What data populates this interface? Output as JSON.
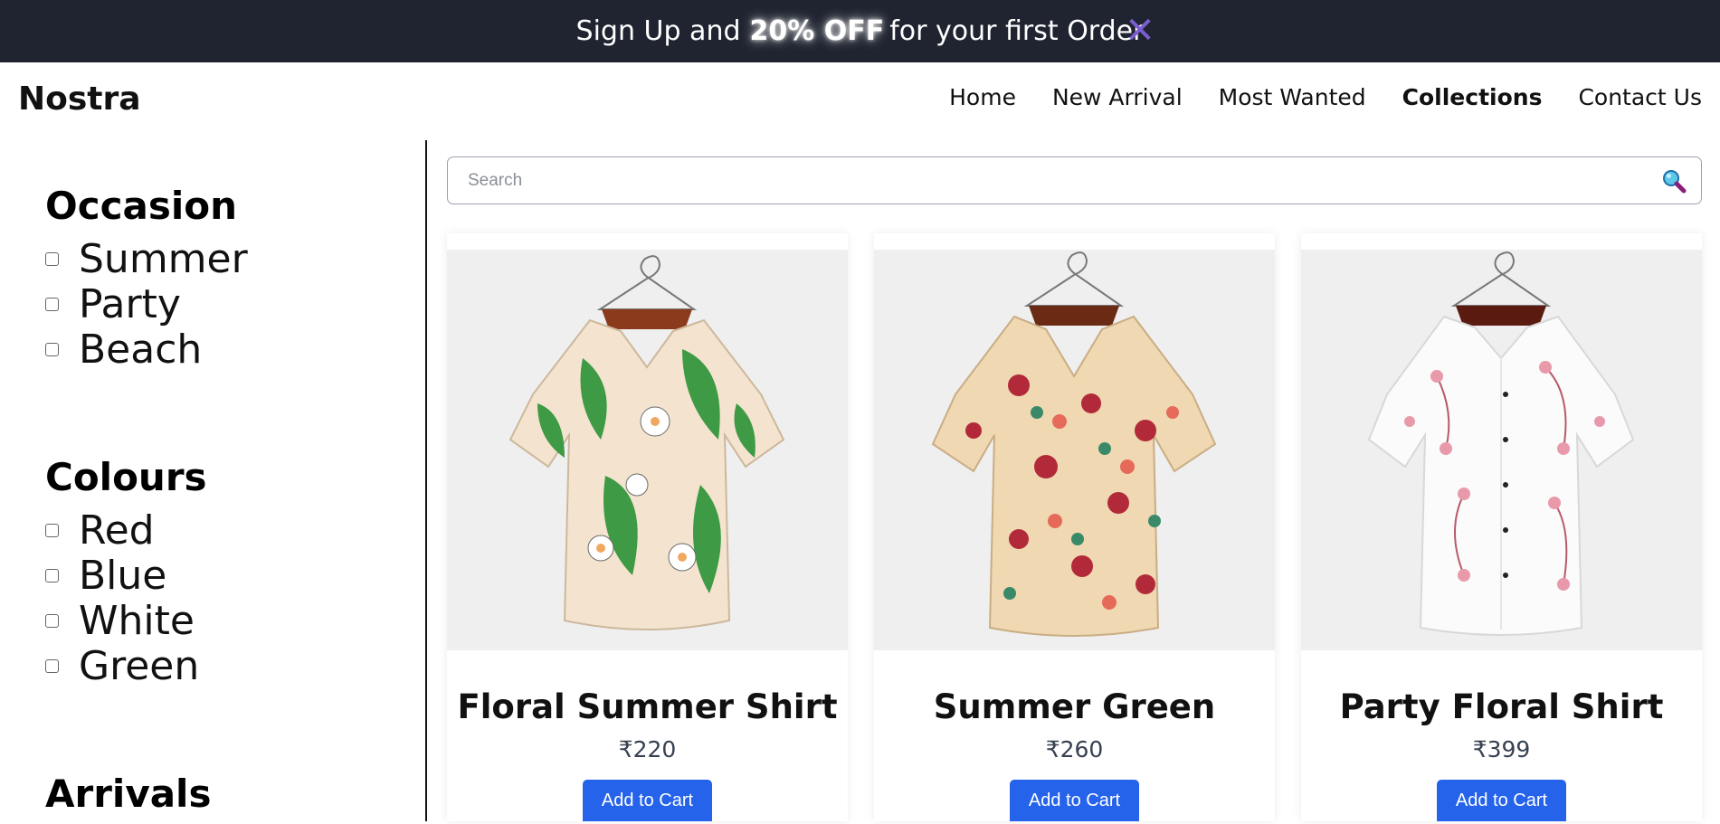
{
  "promo": {
    "pre_text": "Sign Up and",
    "highlight_text": "20% OFF",
    "post_text": "for your first Order",
    "close_glyph": "✕",
    "background_color": "#1f2430",
    "close_color": "#7b5fd0"
  },
  "header": {
    "brand": "Nostra",
    "nav": [
      {
        "label": "Home"
      },
      {
        "label": "New Arrival"
      },
      {
        "label": "Most Wanted"
      },
      {
        "label": "Collections",
        "active": true
      },
      {
        "label": "Contact Us"
      }
    ]
  },
  "sidebar": {
    "occasion": {
      "title": "Occasion",
      "options": [
        "Summer",
        "Party",
        "Beach"
      ]
    },
    "colours": {
      "title": "Colours",
      "options": [
        "Red",
        "Blue",
        "White",
        "Green"
      ]
    },
    "arrivals": {
      "title": "Arrivals"
    }
  },
  "search": {
    "placeholder": "Search",
    "icon": "magnifier-icon"
  },
  "products": [
    {
      "title": "Floral Summer Shirt",
      "price": "₹220",
      "button": "Add to Cart",
      "pattern": "green-lily-floral"
    },
    {
      "title": "Summer Green",
      "price": "₹260",
      "button": "Add to Cart",
      "pattern": "red-rose-floral"
    },
    {
      "title": "Party Floral Shirt",
      "price": "₹399",
      "button": "Add to Cart",
      "pattern": "pink-blossom-floral"
    }
  ],
  "colors": {
    "button": "#2563eb",
    "price": "#374151"
  }
}
